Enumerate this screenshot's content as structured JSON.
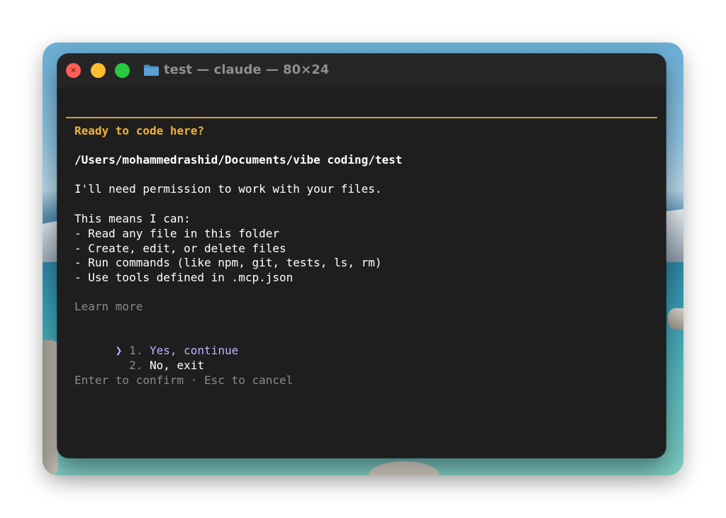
{
  "window": {
    "title": "test — claude — 80×24"
  },
  "prompt": {
    "heading": "Ready to code here?",
    "path": "/Users/mohammedrashid/Documents/vibe coding/test",
    "intro": "I'll need permission to work with your files.",
    "means_heading": "This means I can:",
    "capabilities": [
      "- Read any file in this folder",
      "- Create, edit, or delete files",
      "- Run commands (like npm, git, tests, ls, rm)",
      "- Use tools defined in .mcp.json"
    ],
    "learn_more": "Learn more",
    "options": [
      {
        "pointer": "❯",
        "number": "1.",
        "label": "Yes, continue",
        "selected": true
      },
      {
        "pointer": "",
        "number": "2.",
        "label": "No, exit",
        "selected": false
      }
    ],
    "footer": "Enter to confirm · Esc to cancel"
  },
  "colors": {
    "accent": "#f0b13a",
    "selection": "#b7b4ff",
    "terminal_bg": "#1e1e1e"
  }
}
